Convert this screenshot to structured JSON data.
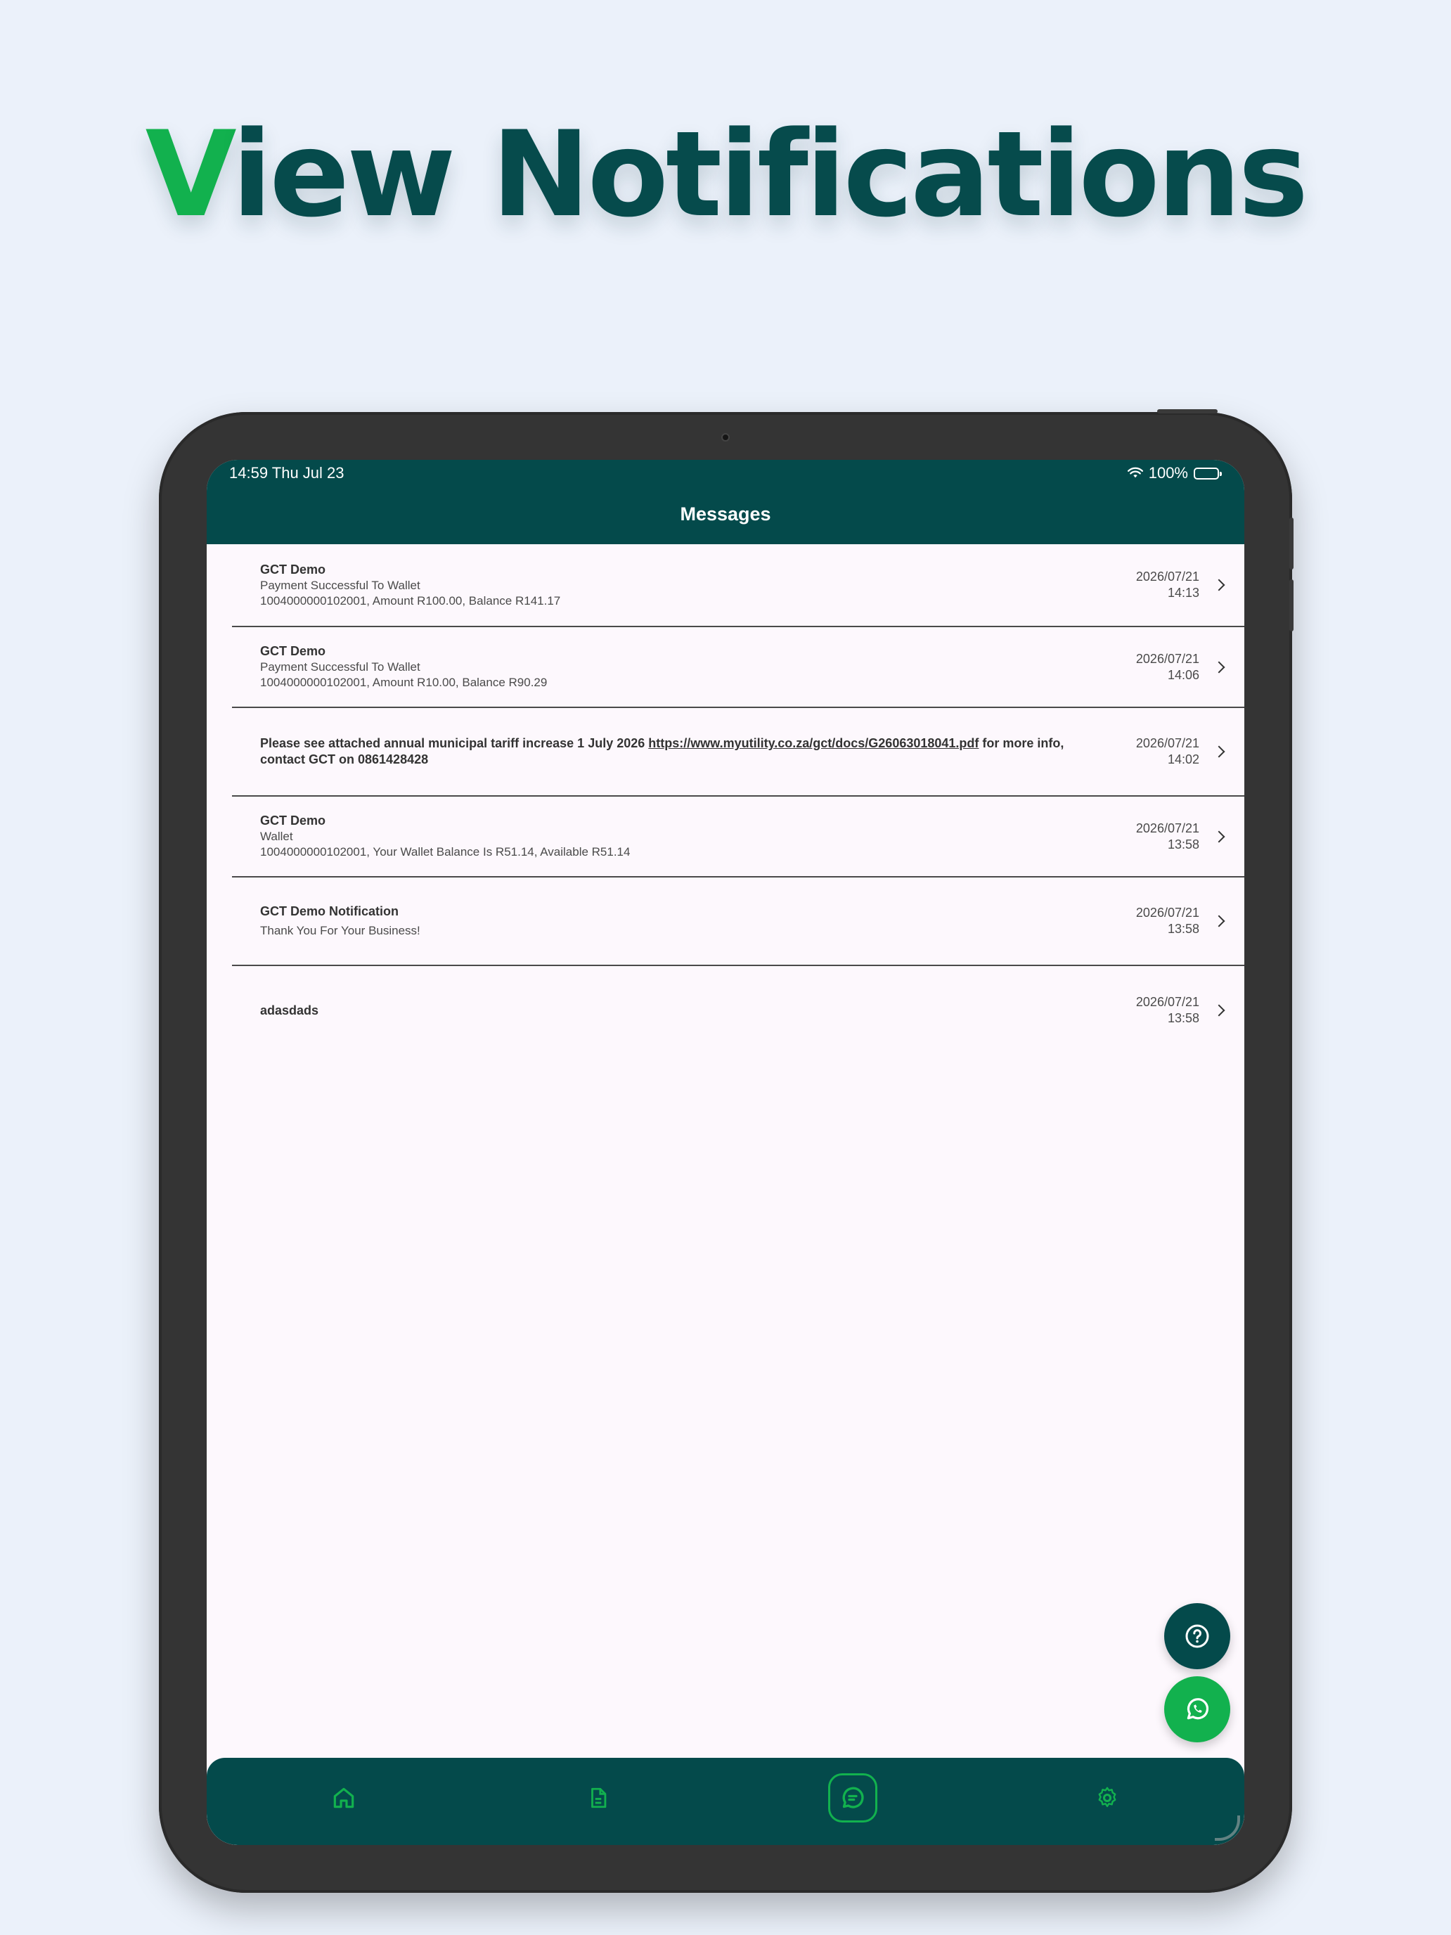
{
  "headline": {
    "first_letter": "V",
    "rest": "iew Notifications"
  },
  "status_bar": {
    "time_date": "14:59  Thu Jul 23",
    "battery": "100%"
  },
  "header": {
    "title": "Messages"
  },
  "messages": [
    {
      "title": "GCT Demo",
      "line1": "Payment Successful To Wallet",
      "line2": "1004000000102001, Amount R100.00, Balance R141.17",
      "date": "2026/07/21",
      "time": "14:13"
    },
    {
      "title": "GCT Demo",
      "line1": "Payment Successful To Wallet",
      "line2": "1004000000102001, Amount R10.00, Balance R90.29",
      "date": "2026/07/21",
      "time": "14:06"
    },
    {
      "text_before": "Please see attached annual municipal tariff increase 1 July 2026 ",
      "link": "https://www.myutility.co.za/gct/docs/G26063018041.pdf",
      "text_after": " for more info, contact GCT on 0861428428",
      "date": "2026/07/21",
      "time": "14:02"
    },
    {
      "title": "GCT Demo",
      "line1": "Wallet",
      "line2": "1004000000102001, Your Wallet Balance Is R51.14, Available R51.14",
      "date": "2026/07/21",
      "time": "13:58"
    },
    {
      "title": "GCT Demo Notification",
      "line1": "Thank You For Your Business!",
      "date": "2026/07/21",
      "time": "13:58"
    },
    {
      "title": "adasdads",
      "date": "2026/07/21",
      "time": "13:58"
    }
  ],
  "icons": {
    "help": "question-circle-icon",
    "whatsapp": "whatsapp-icon",
    "nav": [
      "home-icon",
      "document-icon",
      "message-icon",
      "gear-icon"
    ]
  },
  "colors": {
    "brand_dark": "#044a4b",
    "brand_green": "#12b14e",
    "headline": "#064b4c",
    "background": "#ebf1fa",
    "screen": "#fdf8fd"
  }
}
